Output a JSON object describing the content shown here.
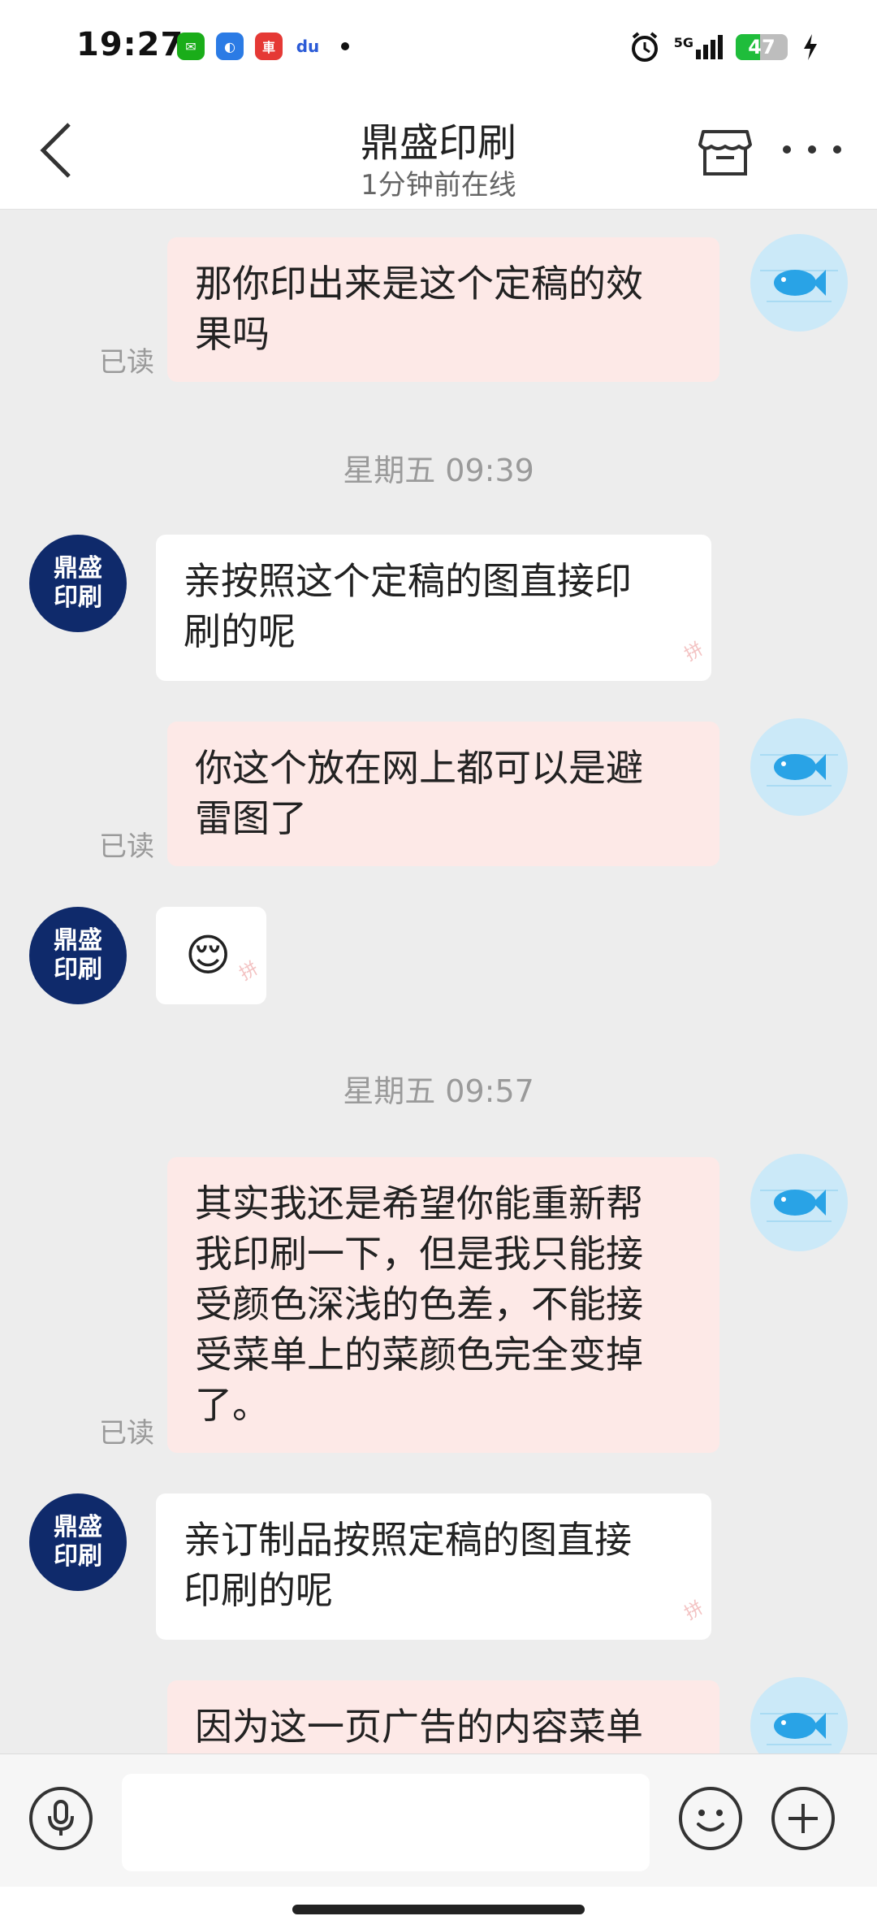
{
  "status_bar": {
    "time": "19:27",
    "apps": [
      {
        "name": "wechat-icon",
        "color": "#1aad19",
        "glyph": "✉"
      },
      {
        "name": "browser-icon",
        "color": "#2b7be5",
        "glyph": "◐"
      },
      {
        "name": "car-app-icon",
        "color": "#e53935",
        "glyph": "車"
      },
      {
        "name": "baidu-icon",
        "color": "#ffffff",
        "glyph": "du"
      }
    ],
    "network": "5G",
    "battery": "47",
    "battery_level": 0.47
  },
  "header": {
    "title": "鼎盛印刷",
    "subtitle": "1分钟前在线"
  },
  "chat": {
    "shop_avatar_line1": "鼎盛",
    "shop_avatar_line2": "印刷",
    "read_label": "已读",
    "messages": [
      {
        "text_line1": "那你印出来是这个定稿的效",
        "text_line2": "果吗"
      },
      {
        "timestamp": "星期五 09:39"
      },
      {
        "text_line1": "亲按照这个定稿的图直接印",
        "text_line2": "刷的呢"
      },
      {
        "text_line1": "你这个放在网上都可以是避",
        "text_line2": "雷图了"
      },
      {
        "emoji": "😌"
      },
      {
        "timestamp": "星期五 09:57"
      },
      {
        "lines": [
          "其实我还是希望你能重新帮",
          "我印刷一下，但是我只能接",
          "受颜色深浅的色差，不能接",
          "受菜单上的菜颜色完全变掉",
          "了。"
        ]
      },
      {
        "text_line1": "亲订制品按照定稿的图直接",
        "text_line2": "印刷的呢"
      },
      {
        "text_line1": "因为这一页广告的内容菜单"
      }
    ]
  },
  "watermark": "拼",
  "colors": {
    "my_bubble": "#fde9e7",
    "shop_bubble": "#ffffff",
    "shop_avatar": "#0f2a6b",
    "my_avatar": "#cbe9f8",
    "fish": "#29a3e6"
  }
}
